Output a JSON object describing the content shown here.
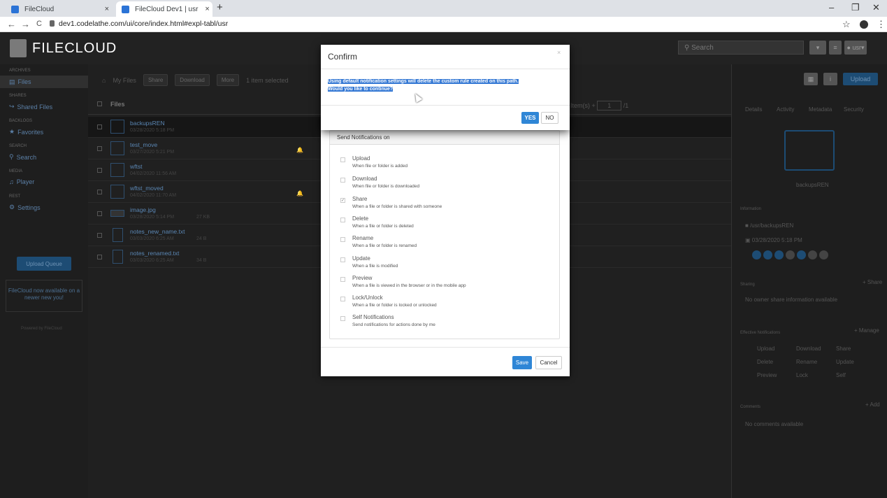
{
  "browser": {
    "tabs": [
      {
        "title": "FileCloud"
      },
      {
        "title": "FileCloud Dev1 | usr"
      }
    ],
    "new_tab": "+",
    "tab_close": "×",
    "url": "dev1.codelathe.com/ui/core/index.html#expl-tabl/usr",
    "win_minimize": "–",
    "win_restore": "❐",
    "win_close": "✕",
    "star": "☆",
    "menu": "⋮",
    "back": "←",
    "forward": "→",
    "reload": "C"
  },
  "app": {
    "logo": "FILECLOUD",
    "search_placeholder": "Search",
    "user": "usr",
    "sidebar": {
      "sections": [
        {
          "header": "ARCHIVES",
          "item": "Files"
        },
        {
          "header": "SHARES",
          "item": "Shared Files"
        },
        {
          "header": "BACKLOGS",
          "item": "Favorites"
        },
        {
          "header": "SEARCH",
          "item": "Search"
        },
        {
          "header": "MEDIA",
          "item": "Player"
        },
        {
          "header": "REST",
          "item": "Settings"
        }
      ],
      "upload_queue": "Upload Queue",
      "promo": "FileCloud now available on a newer new you!",
      "powered": "Powered by FileCloud"
    },
    "toolbar": {
      "home": "My Files",
      "share": "Share",
      "download": "Download",
      "more": "More",
      "selected": "1 item selected"
    },
    "files_header": "Files",
    "pager": {
      "items": "Item(s)",
      "page": "1",
      "total": "/1"
    },
    "files": [
      {
        "name": "backupsREN",
        "date": "03/28/2020 5:18 PM",
        "size": ""
      },
      {
        "name": "test_move",
        "date": "03/27/2020 5:21 PM",
        "size": ""
      },
      {
        "name": "wftst",
        "date": "04/02/2020 11:56 AM",
        "size": ""
      },
      {
        "name": "wftst_moved",
        "date": "04/02/2020 11:70 AM",
        "size": ""
      },
      {
        "name": "image.jpg",
        "date": "03/28/2020 5:14 PM",
        "size": "27 KB"
      },
      {
        "name": "notes_new_name.txt",
        "date": "03/03/2020 6:25 AM",
        "size": "24 B"
      },
      {
        "name": "notes_renamed.txt",
        "date": "03/03/2020 6:25 AM",
        "size": "34 B"
      }
    ],
    "right_panel": {
      "tabs": [
        "Details",
        "Activity",
        "Metadata",
        "Security"
      ],
      "folder_name": "backupsREN",
      "info_header": "Information",
      "path": "/usr/backupsREN",
      "date": "03/28/2020 5:18 PM",
      "sharing_header": "Sharing",
      "share_link": "+ Share",
      "sharing_text": "No owner share information available",
      "notif_header": "Effective Notifications",
      "manage_link": "+ Manage",
      "notif_items": [
        "Upload",
        "Download",
        "Share",
        "Delete",
        "Rename",
        "Update",
        "Preview",
        "Lock",
        "Self"
      ],
      "comments_header": "Comments",
      "add_link": "+ Add",
      "comments_text": "No comments available",
      "upload_btn": "Upload"
    }
  },
  "notify_dialog": {
    "section_title": "Send Notifications on",
    "options": [
      {
        "title": "Upload",
        "desc": "When file or folder is added",
        "checked": false
      },
      {
        "title": "Download",
        "desc": "When file or folder is downloaded",
        "checked": false
      },
      {
        "title": "Share",
        "desc": "When a file or folder is shared with someone",
        "checked": true
      },
      {
        "title": "Delete",
        "desc": "When a file or folder is deleted",
        "checked": false
      },
      {
        "title": "Rename",
        "desc": "When a file or folder is renamed",
        "checked": false
      },
      {
        "title": "Update",
        "desc": "When a file is modified",
        "checked": false
      },
      {
        "title": "Preview",
        "desc": "When a file is viewed in the browser or in the mobile app",
        "checked": false
      },
      {
        "title": "Lock/Unlock",
        "desc": "When a file or folder is locked or unlocked",
        "checked": false
      },
      {
        "title": "Self Notifications",
        "desc": "Send notifications for actions done by me",
        "checked": false
      }
    ],
    "save": "Save",
    "cancel": "Cancel"
  },
  "confirm_dialog": {
    "title": "Confirm",
    "close": "×",
    "message_line1": "Using default notification settings will delete the custom rule created on this path.",
    "message_line2": "Would you like to continue?",
    "yes": "YES",
    "no": "NO"
  },
  "colors": {
    "accent": "#2f86d6",
    "selection": "#3478d4"
  }
}
